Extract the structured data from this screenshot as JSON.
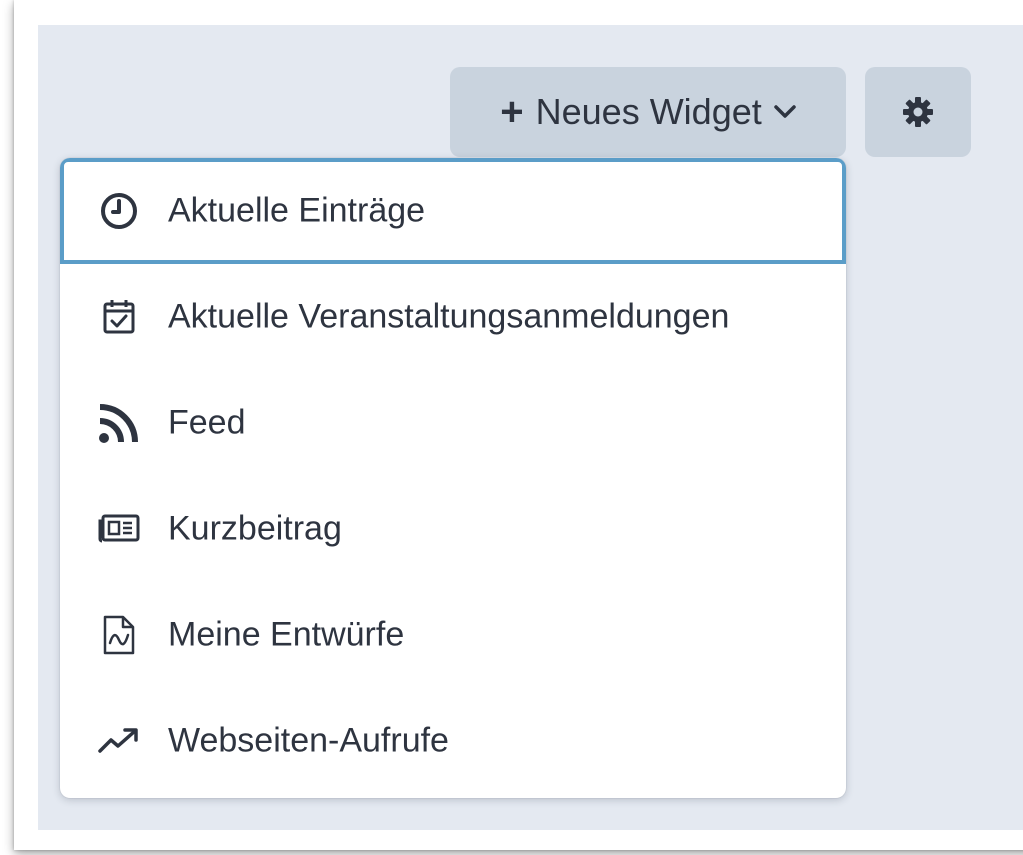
{
  "toolbar": {
    "new_widget_label": "Neues Widget",
    "new_widget_icon": "plus-icon",
    "dropdown_icon": "chevron-down-icon",
    "settings_icon": "gear-icon"
  },
  "menu": {
    "items": [
      {
        "label": "Aktuelle Einträge",
        "icon": "clock-icon",
        "active": true
      },
      {
        "label": "Aktuelle Veranstaltungsanmeldungen",
        "icon": "calendar-check-icon"
      },
      {
        "label": "Feed",
        "icon": "rss-icon"
      },
      {
        "label": "Kurzbeitrag",
        "icon": "newspaper-icon"
      },
      {
        "label": "Meine Entwürfe",
        "icon": "draft-file-icon"
      },
      {
        "label": "Webseiten-Aufrufe",
        "icon": "trending-up-icon"
      }
    ]
  },
  "colors": {
    "background": "#e4e9f1",
    "button": "#c9d3de",
    "text": "#2e3440",
    "focus_border": "#5b9dc8"
  }
}
